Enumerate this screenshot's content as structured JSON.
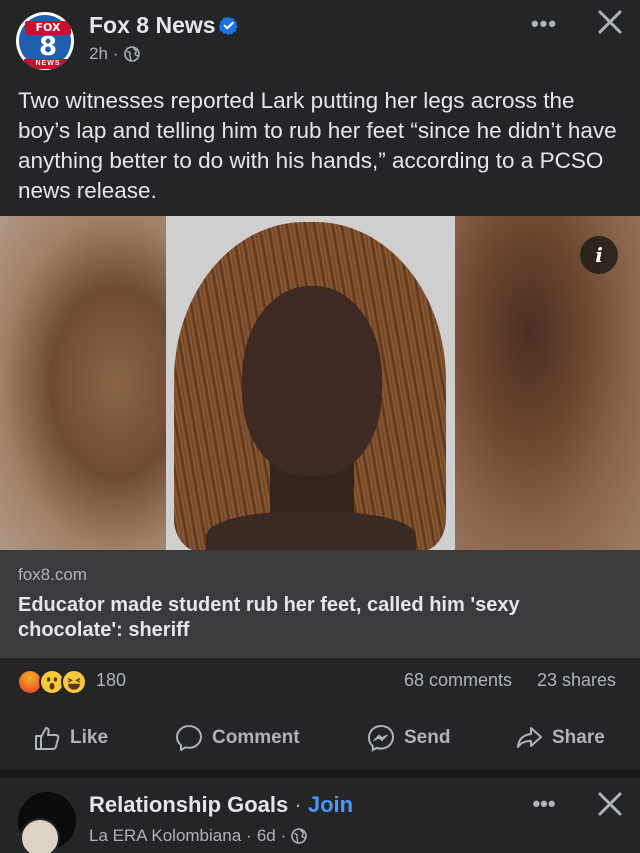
{
  "post": {
    "page_name": "Fox 8 News",
    "logo_top": "FOX",
    "logo_number": "8",
    "logo_bottom": "NEWS",
    "time": "2h",
    "separator": "·",
    "text": "Two witnesses reported Lark putting her legs across the boy’s lap and telling him to rub her feet “since he didn’t have anything better to do with his hands,” according to a PCSO news release.",
    "more_label": "•••",
    "info_label": "i",
    "link": {
      "domain": "fox8.com",
      "title": "Educator made student rub her feet, called him 'sexy chocolate': sheriff"
    },
    "reactions": {
      "icons": [
        "angry-reaction-icon",
        "wow-reaction-icon",
        "haha-reaction-icon"
      ],
      "count": "180",
      "comments": "68 comments",
      "shares": "23 shares"
    },
    "actions": {
      "like": "Like",
      "comment": "Comment",
      "send": "Send",
      "share": "Share"
    }
  },
  "next_post": {
    "name": "Relationship Goals",
    "separator": " · ",
    "join": "Join",
    "author": "La ERA Kolombiana",
    "time": "6d",
    "meta_separator": "·",
    "more_label": "•••"
  },
  "colors": {
    "background": "#242526",
    "link_box": "#3a3b3c",
    "primary_text": "#e4e6eb",
    "secondary_text": "#b0b3b8",
    "accent": "#4599ff",
    "verified": "#1b74e4"
  }
}
